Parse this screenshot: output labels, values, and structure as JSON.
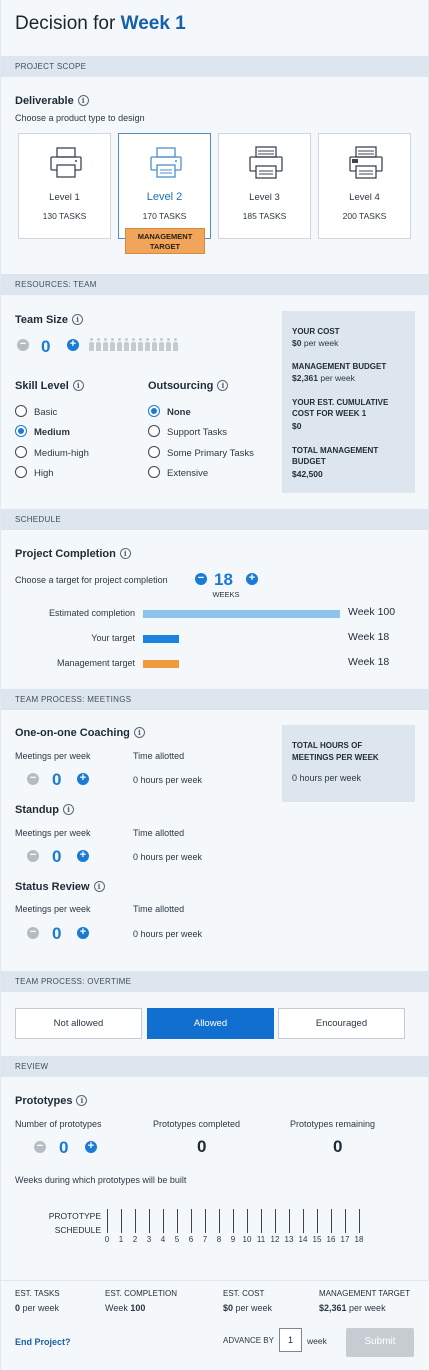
{
  "header": {
    "title_prefix": "Decision for",
    "title_week": "Week 1"
  },
  "project_scope": {
    "section_label": "PROJECT SCOPE",
    "deliverable_label": "Deliverable",
    "deliverable_hint": "Choose a product type to design",
    "cards": [
      {
        "name": "Level 1",
        "tasks": "130 TASKS",
        "selected": false
      },
      {
        "name": "Level 2",
        "tasks": "170 TASKS",
        "selected": true
      },
      {
        "name": "Level 3",
        "tasks": "185 TASKS",
        "selected": false
      },
      {
        "name": "Level 4",
        "tasks": "200 TASKS",
        "selected": false
      }
    ],
    "badge": "MANAGEMENT TARGET"
  },
  "resources": {
    "section_label": "RESOURCES: TEAM",
    "team_size_label": "Team Size",
    "team_size_value": "0",
    "skill_label": "Skill Level",
    "skill_options": [
      "Basic",
      "Medium",
      "Medium-high",
      "High"
    ],
    "skill_selected": "Medium",
    "outsourcing_label": "Outsourcing",
    "outsourcing_options": [
      "None",
      "Support Tasks",
      "Some Primary Tasks",
      "Extensive"
    ],
    "outsourcing_selected": "None",
    "summary": {
      "your_cost_label": "YOUR COST",
      "your_cost_value": "$0",
      "your_cost_unit": "per week",
      "mgmt_budget_label": "MANAGEMENT BUDGET",
      "mgmt_budget_value": "$2,361",
      "mgmt_budget_unit": "per week",
      "cumulative_label": "YOUR EST. CUMULATIVE COST FOR WEEK 1",
      "cumulative_value": "$0",
      "total_label": "TOTAL MANAGEMENT BUDGET",
      "total_value": "$42,500"
    }
  },
  "schedule": {
    "section_label": "SCHEDULE",
    "completion_label": "Project Completion",
    "hint": "Choose a target for project completion",
    "target_value": "18",
    "target_unit": "WEEKS",
    "rows": [
      {
        "label": "Estimated completion",
        "value": "Week 100",
        "weeks": 100,
        "color": "#8dc3ec"
      },
      {
        "label": "Your target",
        "value": "Week 18",
        "weeks": 18,
        "color": "#1a84e0"
      },
      {
        "label": "Management target",
        "value": "Week 18",
        "weeks": 18,
        "color": "#f09a3e"
      }
    ]
  },
  "meetings": {
    "section_label": "TEAM PROCESS: MEETINGS",
    "per_week_label": "Meetings per week",
    "time_label": "Time allotted",
    "groups": [
      {
        "title": "One-on-one Coaching",
        "value": "0",
        "time": "0 hours per week"
      },
      {
        "title": "Standup",
        "value": "0",
        "time": "0 hours per week"
      },
      {
        "title": "Status Review",
        "value": "0",
        "time": "0 hours per week"
      }
    ],
    "total_label": "TOTAL HOURS OF MEETINGS PER WEEK",
    "total_value": "0 hours per week"
  },
  "overtime": {
    "section_label": "TEAM PROCESS: OVERTIME",
    "options": [
      "Not allowed",
      "Allowed",
      "Encouraged"
    ],
    "selected": "Allowed"
  },
  "review": {
    "section_label": "REVIEW",
    "prototypes_label": "Prototypes",
    "number_label": "Number of prototypes",
    "number_value": "0",
    "completed_label": "Prototypes completed",
    "completed_value": "0",
    "remaining_label": "Prototypes remaining",
    "remaining_value": "0",
    "weeks_hint": "Weeks during which prototypes will be built",
    "schedule_label_1": "PROTOTYPE",
    "schedule_label_2": "SCHEDULE",
    "ticks": [
      "0",
      "1",
      "2",
      "3",
      "4",
      "5",
      "6",
      "7",
      "8",
      "9",
      "10",
      "11",
      "12",
      "13",
      "14",
      "15",
      "16",
      "17",
      "18"
    ]
  },
  "footer": {
    "est_tasks_label": "EST. TASKS",
    "est_tasks_value": "0",
    "est_tasks_unit": "per week",
    "est_completion_label": "EST. COMPLETION",
    "est_completion_prefix": "Week",
    "est_completion_value": "100",
    "est_cost_label": "EST. COST",
    "est_cost_value": "$0",
    "est_cost_unit": "per week",
    "mgmt_target_label": "MANAGEMENT TARGET",
    "mgmt_target_value": "$2,361",
    "mgmt_target_unit": "per week",
    "end_project": "End Project?",
    "advance_label": "ADVANCE BY",
    "advance_value": "1",
    "advance_unit": "week",
    "submit": "Submit"
  }
}
